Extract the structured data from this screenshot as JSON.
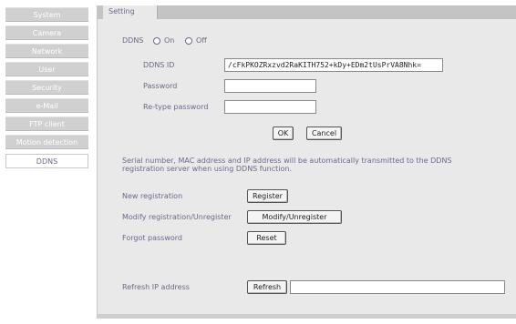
{
  "sidebar": {
    "items": [
      {
        "label": "System"
      },
      {
        "label": "Camera"
      },
      {
        "label": "Network"
      },
      {
        "label": "User"
      },
      {
        "label": "Security"
      },
      {
        "label": "e-Mail"
      },
      {
        "label": "FTP client"
      },
      {
        "label": "Motion detection"
      },
      {
        "label": "DDNS"
      }
    ]
  },
  "tab": {
    "label": "Setting"
  },
  "ddns": {
    "label": "DDNS",
    "on_label": "On",
    "off_label": "Off",
    "id_label": "DDNS ID",
    "id_value": "/cFkPKOZRxzvd2RaKITH752+kDy+EDm2tUsPrVA8Nhk=",
    "password_label": "Password",
    "retype_label": "Re-type password",
    "ok_label": "OK",
    "cancel_label": "Cancel"
  },
  "note": {
    "line1": "Serial number, MAC address and IP address will be automatically transmitted to the DDNS",
    "line2": "registration server when using DDNS function."
  },
  "registration": {
    "new_label": "New registration",
    "register_btn": "Register",
    "modify_label": "Modify registration/Unregister",
    "modify_btn": "Modify/Unregister",
    "forgot_label": "Forgot password",
    "reset_btn": "Reset"
  },
  "refresh": {
    "label": "Refresh IP address",
    "button": "Refresh",
    "value": ""
  }
}
